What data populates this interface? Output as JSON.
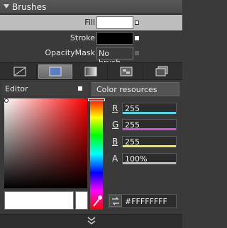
{
  "header": {
    "title": "Brushes"
  },
  "brushes": [
    {
      "label": "Fill",
      "swatch": "#FFFFFF"
    },
    {
      "label": "Stroke",
      "swatch": "#000000"
    },
    {
      "label": "OpacityMask",
      "value": "No brush"
    }
  ],
  "brush_types": [
    "no-brush-icon",
    "solid-color-brush-icon",
    "gradient-brush-icon",
    "tile-brush-icon",
    "brush-resources-icon"
  ],
  "editor": {
    "tab_label": "Editor",
    "resources_label": "Color resources",
    "channels": [
      {
        "label": "R",
        "value": "255",
        "bar_color": "#4fd8e8"
      },
      {
        "label": "G",
        "value": "255",
        "bar_color": "#d84fd8"
      },
      {
        "label": "B",
        "value": "255",
        "bar_color": "#e8e84f"
      },
      {
        "label": "A",
        "value": "100%",
        "bar_color": "#bdbdbd"
      }
    ],
    "hex": "#FFFFFFFF",
    "selected_color": "#FFFFFF"
  },
  "footer": {
    "expander": "expand-chevron-icon"
  }
}
